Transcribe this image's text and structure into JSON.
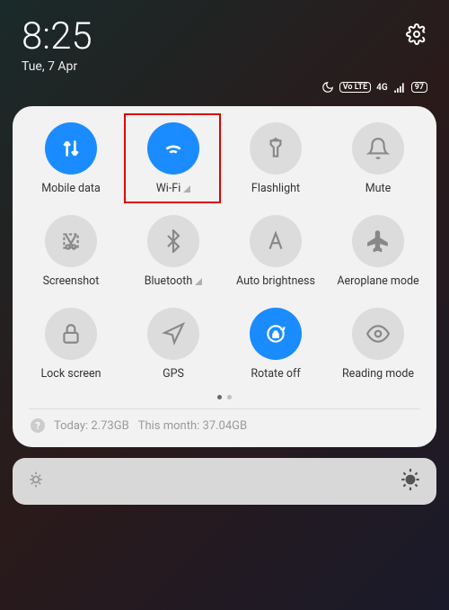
{
  "header": {
    "time": "8:25",
    "date": "Tue, 7 Apr"
  },
  "status": {
    "volte": "Vo LTE",
    "net": "4G",
    "battery": "97"
  },
  "tiles": [
    {
      "label": "Mobile data",
      "active": true,
      "icon": "arrows-up-down",
      "chevron": false
    },
    {
      "label": "Wi-Fi",
      "active": true,
      "icon": "wifi",
      "chevron": true
    },
    {
      "label": "Flashlight",
      "active": false,
      "icon": "flashlight",
      "chevron": false
    },
    {
      "label": "Mute",
      "active": false,
      "icon": "bell",
      "chevron": false
    },
    {
      "label": "Screenshot",
      "active": false,
      "icon": "scissors",
      "chevron": false
    },
    {
      "label": "Bluetooth",
      "active": false,
      "icon": "bluetooth",
      "chevron": true
    },
    {
      "label": "Auto brightness",
      "active": false,
      "icon": "letter-a",
      "chevron": false
    },
    {
      "label": "Aeroplane mode",
      "active": false,
      "icon": "airplane",
      "chevron": false
    },
    {
      "label": "Lock screen",
      "active": false,
      "icon": "lock",
      "chevron": false
    },
    {
      "label": "GPS",
      "active": false,
      "icon": "navigation",
      "chevron": false
    },
    {
      "label": "Rotate off",
      "active": true,
      "icon": "rotate-lock",
      "chevron": false
    },
    {
      "label": "Reading mode",
      "active": false,
      "icon": "eye",
      "chevron": false
    }
  ],
  "usage": {
    "today_label": "Today:",
    "today_value": "2.73GB",
    "month_label": "This month:",
    "month_value": "37.04GB"
  },
  "highlighted_tile_index": 1
}
